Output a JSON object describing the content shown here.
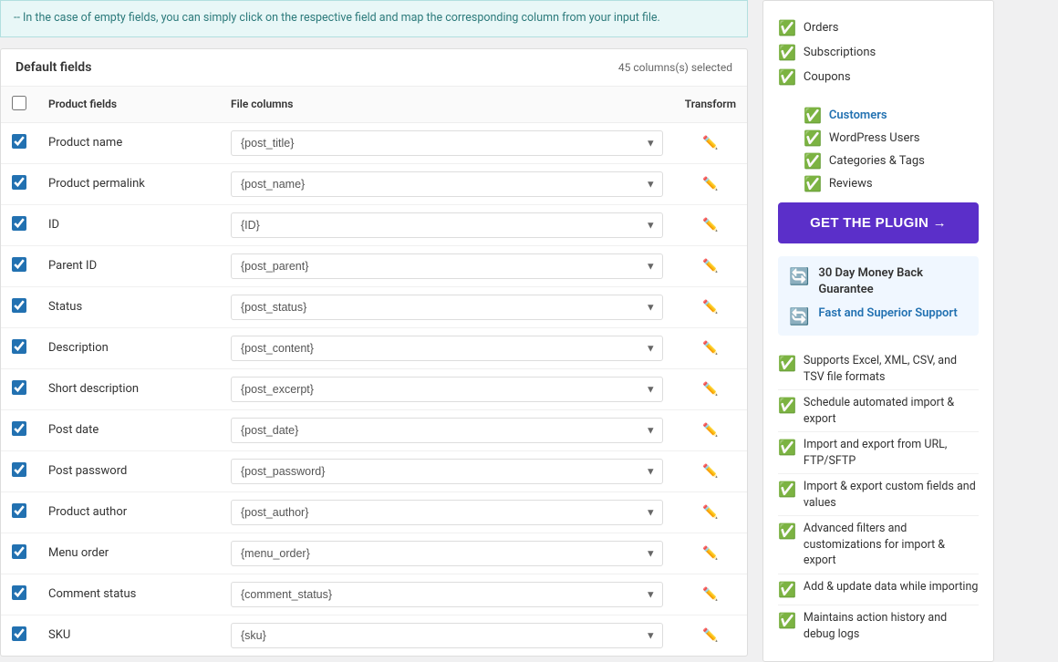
{
  "banner": {
    "text": "-- In the case of empty fields, you can simply click on the respective field and map the corresponding column from your input file."
  },
  "fields_section": {
    "title": "Default fields",
    "count": "45 columns(s) selected",
    "columns": {
      "checkbox": "",
      "product_fields": "Product fields",
      "file_columns": "File columns",
      "transform": "Transform"
    },
    "rows": [
      {
        "checked": true,
        "name": "Product name",
        "value": "{post_title}"
      },
      {
        "checked": true,
        "name": "Product permalink",
        "value": "{post_name}"
      },
      {
        "checked": true,
        "name": "ID",
        "value": "{ID}"
      },
      {
        "checked": true,
        "name": "Parent ID",
        "value": "{post_parent}"
      },
      {
        "checked": true,
        "name": "Status",
        "value": "{post_status}"
      },
      {
        "checked": true,
        "name": "Description",
        "value": "{post_content}"
      },
      {
        "checked": true,
        "name": "Short description",
        "value": "{post_excerpt}"
      },
      {
        "checked": true,
        "name": "Post date",
        "value": "{post_date}"
      },
      {
        "checked": true,
        "name": "Post password",
        "value": "{post_password}"
      },
      {
        "checked": true,
        "name": "Product author",
        "value": "{post_author}"
      },
      {
        "checked": true,
        "name": "Menu order",
        "value": "{menu_order}"
      },
      {
        "checked": true,
        "name": "Comment status",
        "value": "{comment_status}"
      },
      {
        "checked": true,
        "name": "SKU",
        "value": "{sku}"
      }
    ]
  },
  "sidebar": {
    "features": [
      {
        "label": "Orders"
      },
      {
        "label": "Subscriptions"
      },
      {
        "label": "Coupons"
      }
    ],
    "sub_features": [
      {
        "label": "Customers",
        "highlight": true
      },
      {
        "label": "WordPress Users"
      },
      {
        "label": "Categories & Tags"
      },
      {
        "label": "Reviews"
      }
    ],
    "get_plugin_label": "GET THE PLUGIN →",
    "guarantee": {
      "money_back": "30 Day Money Back Guarantee",
      "support": "Fast and Superior Support"
    },
    "feature_list": [
      {
        "text": "Supports Excel, XML, CSV, and TSV file formats"
      },
      {
        "text": "Schedule automated import & export"
      },
      {
        "text": "Import and export from URL, FTP/SFTP"
      },
      {
        "text": "Import & export custom fields and values"
      },
      {
        "text": "Advanced filters and customizations for import & export"
      },
      {
        "text": "Add & update data while importing"
      },
      {
        "text": "Maintains action history and debug logs"
      }
    ]
  }
}
